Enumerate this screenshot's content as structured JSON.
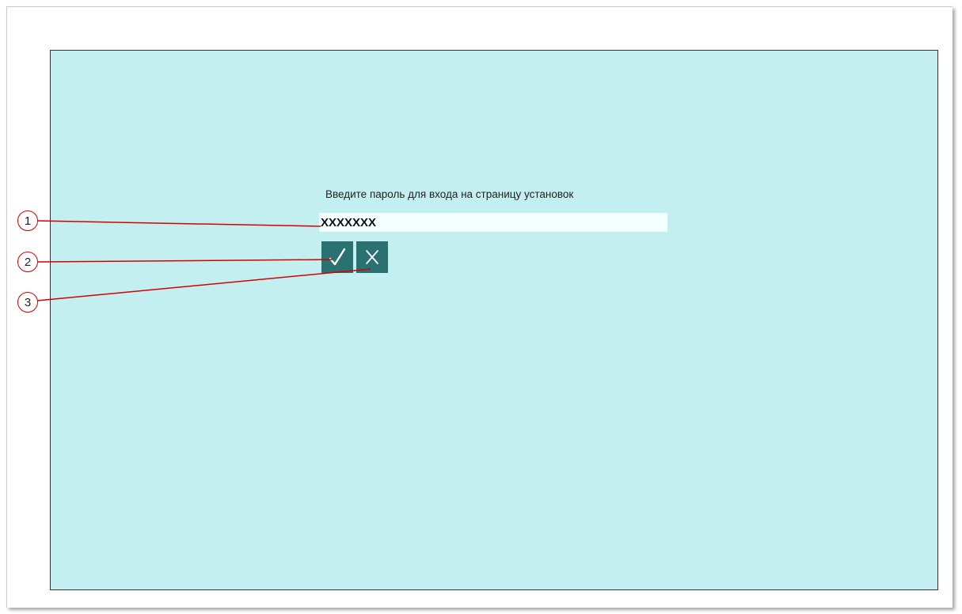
{
  "dialog": {
    "prompt": "Введите пароль для входа на страницу установок",
    "password_value": "XXXXXXX",
    "ok_icon": "checkmark-icon",
    "cancel_icon": "cross-icon"
  },
  "callouts": [
    "1",
    "2",
    "3"
  ],
  "colors": {
    "panel_background": "#c4eff0",
    "button_background": "#2a7172",
    "field_background": "#f4ffff",
    "callout_line": "#d40000"
  }
}
